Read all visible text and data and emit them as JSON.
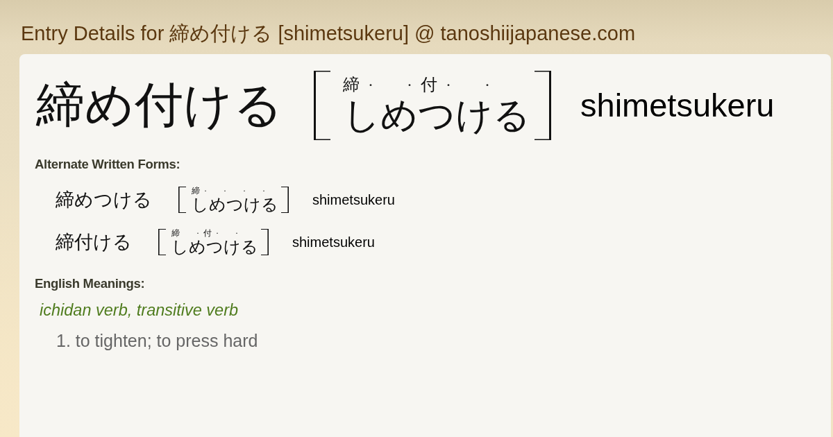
{
  "page_title": "Entry Details for 締め付ける [shimetsukeru] @ tanoshiijapanese.com",
  "entry": {
    "written": "締め付ける",
    "reading": {
      "marks": "締·  ·付·  ·",
      "kana": "しめつける"
    },
    "romaji": "shimetsukeru"
  },
  "alternate_forms": {
    "heading": "Alternate Written Forms:",
    "items": [
      {
        "written": "締めつける",
        "reading": {
          "marks": "締·  ·  ·  ·",
          "kana": "しめつける"
        },
        "romaji": "shimetsukeru"
      },
      {
        "written": "締付ける",
        "reading": {
          "marks": "締  ·付·  ·",
          "kana": "しめつける"
        },
        "romaji": "shimetsukeru"
      }
    ]
  },
  "meanings": {
    "heading": "English Meanings:",
    "part_of_speech": "ichidan verb, transitive verb",
    "senses": [
      "1. to tighten; to press hard"
    ]
  }
}
